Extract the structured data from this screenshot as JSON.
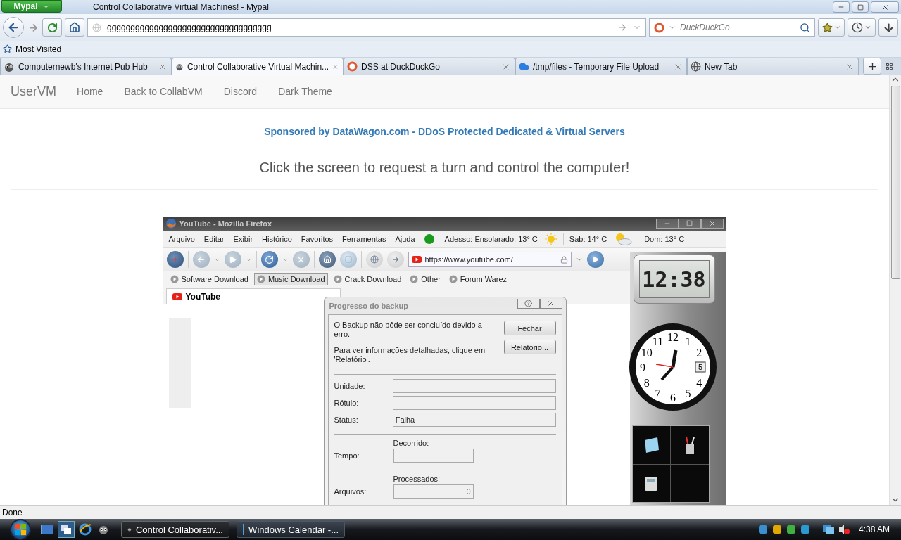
{
  "window": {
    "title": "Control Collaborative Virtual Machines! - Mypal",
    "app_button": "Mypal"
  },
  "toolbar": {
    "url": "ggggggggggggggggggggggggggggggggggg",
    "search_placeholder": "DuckDuckGo"
  },
  "bookmarks": [
    "Most Visited"
  ],
  "tabs": [
    {
      "label": "Computernewb's Internet Pub Hub",
      "selected": false
    },
    {
      "label": "Control Collaborative Virtual Machin...",
      "selected": true
    },
    {
      "label": "DSS at DuckDuckGo",
      "selected": false
    },
    {
      "label": "/tmp/files - Temporary File Upload",
      "selected": false
    },
    {
      "label": "New Tab",
      "selected": false
    }
  ],
  "page": {
    "brand": "UserVM",
    "nav": [
      "Home",
      "Back to CollabVM",
      "Discord",
      "Dark Theme"
    ],
    "sponsor": "Sponsored by DataWagon.com - DDoS Protected Dedicated & Virtual Servers",
    "headline": "Click the screen to request a turn and control the computer!"
  },
  "vm": {
    "title": "YouTube - Mozilla Firefox",
    "menu": [
      "Arquivo",
      "Editar",
      "Exibir",
      "Histórico",
      "Favoritos",
      "Ferramentas",
      "Ajuda"
    ],
    "weather": [
      "Adesso: Ensolarado, 13° C",
      "Sab: 14° C",
      "Dom: 13° C"
    ],
    "url": "https://www.youtube.com/",
    "links": [
      {
        "label": "Software Download",
        "selected": false
      },
      {
        "label": "Music Download",
        "selected": true
      },
      {
        "label": "Crack Download",
        "selected": false
      },
      {
        "label": "Other",
        "selected": false
      },
      {
        "label": "Forum Warez",
        "selected": false
      }
    ],
    "tab": "YouTube",
    "dialog": {
      "title": "Progresso do backup",
      "message": "O Backup não pôde ser concluído devido a erro.",
      "hint": "Para ver informações detalhadas, clique em 'Relatório'.",
      "buttons": [
        "Fechar",
        "Relatório..."
      ],
      "fields": [
        {
          "label": "Unidade:"
        },
        {
          "label": "Rótulo:"
        },
        {
          "label": "Status:",
          "value": "Falha"
        }
      ],
      "time_heading": "Decorrido:",
      "time_label": "Tempo:",
      "files_heading": "Processados:",
      "files_label": "Arquivos:",
      "files_value": "0"
    },
    "gadgets": {
      "digital_clock": "12:38",
      "clock_numbers": [
        "11",
        "12",
        "1",
        "10",
        "2",
        "9",
        "8",
        "4",
        "7",
        "5",
        "6"
      ],
      "date": "5"
    }
  },
  "status_bar": "Done",
  "taskbar": {
    "buttons": [
      {
        "label": "Control Collaborativ...",
        "selected": true
      },
      {
        "label": "Windows Calendar -...",
        "selected": false
      }
    ],
    "clock": "4:38 AM"
  }
}
